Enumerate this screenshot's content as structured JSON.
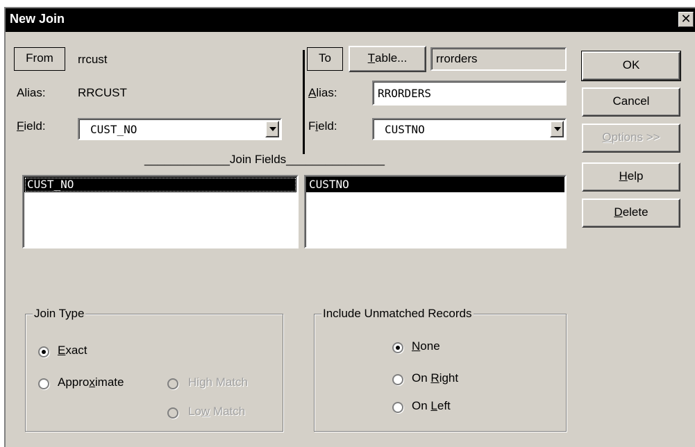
{
  "window": {
    "title": "New Join",
    "close_glyph": "✕"
  },
  "from_panel": {
    "from_label": "From",
    "table_name": "rrcust",
    "alias_label": "Alias:",
    "alias_value": "RRCUST",
    "field_label_prefix": "",
    "field_label_accel": "F",
    "field_label_rest": "ield:",
    "field_value": "CUST_NO"
  },
  "to_panel": {
    "to_label": "To",
    "table_button_accel": "T",
    "table_button_rest": "able...",
    "table_name": "rrorders",
    "alias_label_accel": "A",
    "alias_label_rest": "lias:",
    "alias_value": "RRORDERS",
    "field_label_prefix": "F",
    "field_label_accel": "i",
    "field_label_rest": "eld:",
    "field_value": "CUSTNO"
  },
  "join_fields": {
    "heading": "_____________Join Fields_______________",
    "left_items": [
      "CUST_NO"
    ],
    "right_items": [
      "CUSTNO"
    ]
  },
  "buttons": {
    "ok": "OK",
    "cancel": "Cancel",
    "options_accel": "O",
    "options_rest": "ptions >>",
    "help_accel": "H",
    "help_rest": "elp",
    "delete_accel": "D",
    "delete_rest": "elete"
  },
  "join_type": {
    "legend": "Join Type",
    "exact_accel": "E",
    "exact_rest": "xact",
    "exact_selected": true,
    "approx_pre": "Appro",
    "approx_accel": "x",
    "approx_rest": "imate",
    "high_pre": "Hi",
    "high_accel": "g",
    "high_rest": "h Match",
    "low_pre": "Lo",
    "low_accel": "w",
    "low_rest": " Match"
  },
  "unmatched": {
    "legend": "Include Unmatched Records",
    "none_accel": "N",
    "none_rest": "one",
    "none_selected": true,
    "right_pre": "On ",
    "right_accel": "R",
    "right_rest": "ight",
    "left_pre": "On ",
    "left_accel": "L",
    "left_rest": "eft"
  }
}
